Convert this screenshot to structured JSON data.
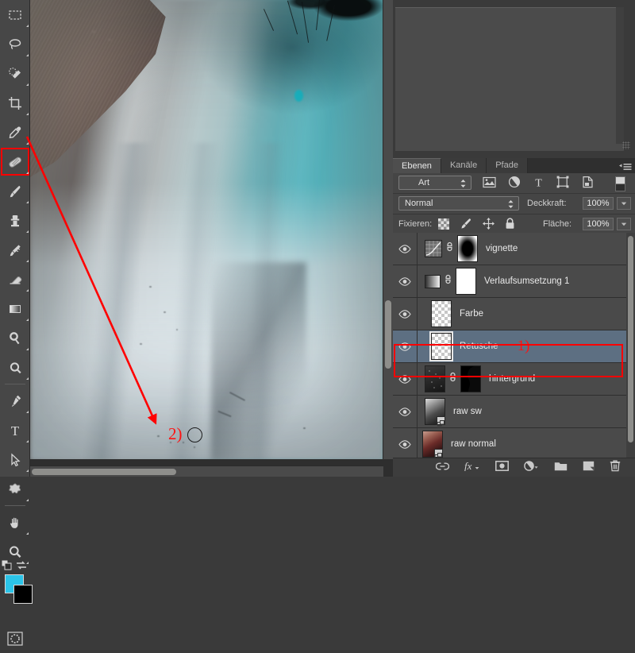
{
  "app": "Adobe Photoshop",
  "toolbar": {
    "tools": [
      {
        "name": "rectangular-marquee-tool",
        "label": "Auswahlrechteck"
      },
      {
        "name": "lasso-tool",
        "label": "Lasso"
      },
      {
        "name": "quick-selection-tool",
        "label": "Schnellauswahl"
      },
      {
        "name": "crop-tool",
        "label": "Freistellungswerkzeug"
      },
      {
        "name": "eyedropper-tool",
        "label": "Pipette"
      },
      {
        "name": "healing-brush-tool",
        "label": "Reparatur-Pinsel"
      },
      {
        "name": "brush-tool",
        "label": "Pinsel"
      },
      {
        "name": "clone-stamp-tool",
        "label": "Kopierstempel"
      },
      {
        "name": "history-brush-tool",
        "label": "Protokollpinsel"
      },
      {
        "name": "eraser-tool",
        "label": "Radiergummi"
      },
      {
        "name": "gradient-tool",
        "label": "Verlaufswerkzeug"
      },
      {
        "name": "dodge-tool",
        "label": "Abwedler"
      },
      {
        "name": "blur-tool",
        "label": "Weichzeichner"
      },
      {
        "name": "pen-tool",
        "label": "Zeichenstift"
      },
      {
        "name": "type-tool",
        "label": "Textwerkzeug"
      },
      {
        "name": "path-selection-tool",
        "label": "Pfadauswahl"
      },
      {
        "name": "custom-shape-tool",
        "label": "Form"
      },
      {
        "name": "hand-tool",
        "label": "Hand"
      },
      {
        "name": "zoom-tool",
        "label": "Zoom"
      }
    ],
    "selected_tool": "healing-brush-tool",
    "foreground_color": "#2bc4e8",
    "background_color": "#000000"
  },
  "annotations": {
    "step1_label": "1)",
    "step2_label": "2)",
    "highlight_color": "#ff0000"
  },
  "panels": {
    "tabs": [
      {
        "label": "Ebenen",
        "active": true
      },
      {
        "label": "Kanäle",
        "active": false
      },
      {
        "label": "Pfade",
        "active": false
      }
    ],
    "filter": {
      "value": "Art",
      "kind_icons": [
        "pixel-layer-filter-icon",
        "adjustment-layer-filter-icon",
        "type-layer-filter-icon",
        "shape-layer-filter-icon",
        "smart-object-filter-icon"
      ]
    },
    "blend": {
      "mode": "Normal",
      "opacity_label": "Deckkraft:",
      "opacity_value": "100%"
    },
    "lock": {
      "label": "Fixieren:",
      "icons": [
        "lock-transparency-icon",
        "lock-image-icon",
        "lock-position-icon",
        "lock-all-icon"
      ],
      "fill_label": "Fläche:",
      "fill_value": "100%"
    },
    "layers": [
      {
        "name": "vignette",
        "thumb": "curves-adjustment",
        "mask": "black-gradient-mask",
        "linked": true,
        "visible": true,
        "selected": false,
        "annotation": ""
      },
      {
        "name": "Verlaufsumsetzung 1",
        "thumb": "gradient-map-adjustment",
        "mask": "white-mask",
        "linked": true,
        "visible": true,
        "selected": false,
        "annotation": ""
      },
      {
        "name": "Farbe",
        "thumb": "transparent-pixels",
        "mask": "",
        "linked": false,
        "visible": true,
        "selected": false,
        "annotation": ""
      },
      {
        "name": "Retusche",
        "thumb": "transparent-pixels",
        "mask": "",
        "linked": false,
        "visible": true,
        "selected": true,
        "annotation": "1)"
      },
      {
        "name": "hintergrund",
        "thumb": "photo-dark",
        "mask": "black-silhouette-mask",
        "linked": true,
        "visible": true,
        "selected": false,
        "annotation": ""
      },
      {
        "name": "raw sw",
        "thumb": "photo-bw-smartobject",
        "mask": "",
        "linked": false,
        "visible": true,
        "selected": false,
        "annotation": ""
      },
      {
        "name": "raw normal",
        "thumb": "photo-color-smartobject",
        "mask": "",
        "linked": false,
        "visible": true,
        "selected": false,
        "annotation": ""
      }
    ],
    "footer_buttons": [
      "link-layers-icon",
      "layer-style-fx-icon",
      "add-layer-mask-icon",
      "new-adjustment-layer-icon",
      "new-group-icon",
      "new-layer-icon",
      "delete-layer-icon"
    ]
  }
}
